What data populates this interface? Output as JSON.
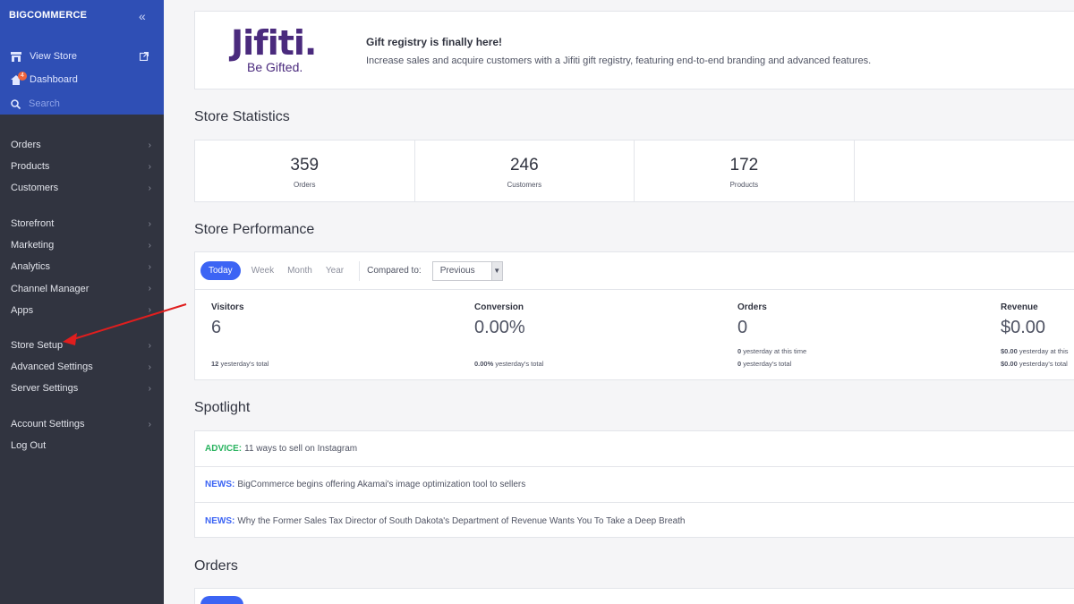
{
  "sidebar": {
    "logo_big": "BIG",
    "logo_rest": "COMMERCE",
    "collapse": "«",
    "view_store": "View Store",
    "dashboard": "Dashboard",
    "dashboard_badge": "4",
    "search_placeholder": "Search",
    "group1": [
      "Orders",
      "Products",
      "Customers"
    ],
    "group2": [
      "Storefront",
      "Marketing",
      "Analytics",
      "Channel Manager",
      "Apps"
    ],
    "group3": [
      "Store Setup",
      "Advanced Settings",
      "Server Settings"
    ],
    "group4": [
      "Account Settings",
      "Log Out"
    ]
  },
  "banner": {
    "logo_text": "Jifiti.",
    "logo_tagline": "Be Gifted.",
    "title": "Gift registry is finally here!",
    "text": "Increase sales and acquire customers with a Jifiti gift registry, featuring end-to-end branding and advanced features."
  },
  "stats": {
    "title": "Store Statistics",
    "items": [
      {
        "value": "359",
        "label": "Orders"
      },
      {
        "value": "246",
        "label": "Customers"
      },
      {
        "value": "172",
        "label": "Products"
      }
    ]
  },
  "performance": {
    "title": "Store Performance",
    "tabs": [
      "Today",
      "Week",
      "Month",
      "Year"
    ],
    "compared_label": "Compared to:",
    "compared_value": "Previous",
    "metrics": {
      "visitors": {
        "title": "Visitors",
        "value": "6",
        "sub1_bold": "12",
        "sub1": "yesterday's total"
      },
      "conversion": {
        "title": "Conversion",
        "value": "0.00%",
        "sub1_bold": "0.00%",
        "sub1": "yesterday's total"
      },
      "orders": {
        "title": "Orders",
        "value": "0",
        "sub1_bold": "0",
        "sub1": "yesterday at this time",
        "sub2_bold": "0",
        "sub2": "yesterday's total"
      },
      "revenue": {
        "title": "Revenue",
        "value": "$0.00",
        "sub1_bold": "$0.00",
        "sub1": "yesterday at this",
        "sub2_bold": "$0.00",
        "sub2": "yesterday's total"
      }
    }
  },
  "spotlight": {
    "title": "Spotlight",
    "items": [
      {
        "tag": "ADVICE:",
        "text": "11 ways to sell on Instagram"
      },
      {
        "tag": "NEWS:",
        "text": "BigCommerce begins offering Akamai's image optimization tool to sellers"
      },
      {
        "tag": "NEWS:",
        "text": "Why the Former Sales Tax Director of South Dakota's Department of Revenue Wants You To Take a Deep Breath"
      }
    ]
  },
  "orders_section": {
    "title": "Orders"
  },
  "colors": {
    "accent": "#3c64f4",
    "sidebar": "#313440",
    "sidebar_top": "#2f4fb5",
    "annotation_arrow": "#e01e1e"
  }
}
